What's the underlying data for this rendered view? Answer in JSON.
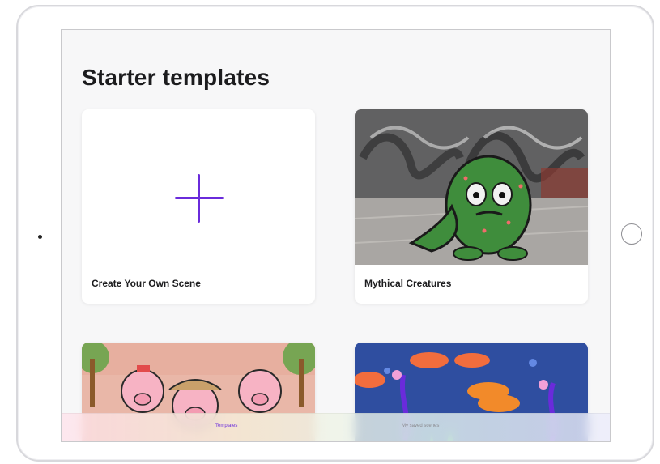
{
  "page": {
    "title": "Starter templates"
  },
  "cards": [
    {
      "label": "Create Your Own Scene",
      "kind": "create",
      "icon": "plus-icon"
    },
    {
      "label": "Mythical Creatures",
      "kind": "template"
    },
    {
      "label": "",
      "kind": "template"
    },
    {
      "label": "",
      "kind": "template"
    }
  ],
  "tabbar": {
    "tabs": [
      {
        "label": "Templates",
        "active": true
      },
      {
        "label": "My saved scenes",
        "active": false
      }
    ]
  },
  "colors": {
    "accent": "#6a2bdb",
    "background": "#f7f7f8",
    "card": "#ffffff"
  }
}
